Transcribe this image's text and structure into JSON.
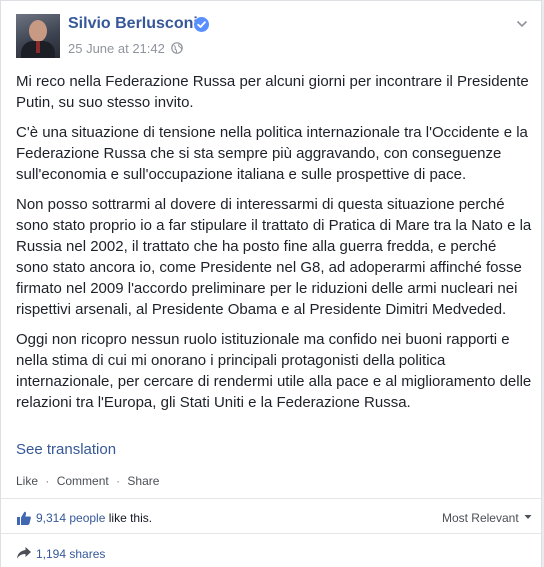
{
  "post": {
    "author": "Silvio Berlusconi",
    "timestamp": "25 June at 21:42",
    "paragraphs": [
      "Mi reco nella Federazione Russa per alcuni giorni per incontrare il Presidente Putin, su suo stesso invito.",
      "C'è una situazione di tensione nella politica internazionale tra l'Occidente e la Federazione Russa che si sta sempre più aggravando, con conseguenze sull'economia e sull'occupazione italiana e sulle prospettive di pace.",
      "Non posso sottrarmi al dovere di interessarmi di questa situazione perché sono stato proprio io a far stipulare il trattato di Pratica di Mare tra la Nato e la Russia nel 2002, il trattato che ha posto fine alla guerra fredda, e perché sono stato ancora io, come Presidente nel G8, ad adoperarmi affinché fosse firmato nel 2009 l'accordo preliminare per le riduzioni delle armi nucleari nei rispettivi arsenali, al Presidente Obama e al Presidente Dimitri Medveded.",
      "Oggi non ricopro nessun ruolo istituzionale ma confido nei buoni rapporti e nella stima di cui mi onorano i principali protagonisti della politica internazionale, per cercare di rendermi utile alla pace e al miglioramento delle relazioni tra l'Europa, gli Stati Uniti e la Federazione Russa."
    ],
    "see_translation": "See translation"
  },
  "actions": {
    "like": "Like",
    "comment": "Comment",
    "share": "Share",
    "separator": "·"
  },
  "reactions": {
    "likes_count": "9,314 people",
    "likes_suffix": "like this.",
    "sort_label": "Most Relevant"
  },
  "shares": {
    "label": "1,194 shares"
  },
  "colors": {
    "link": "#365899",
    "verified": "#5890ff"
  },
  "icons": {
    "verified": "verified-badge-icon",
    "globe": "globe-icon",
    "chevron": "chevron-down-icon",
    "thumb": "thumbs-up-icon",
    "share": "share-arrow-icon"
  }
}
